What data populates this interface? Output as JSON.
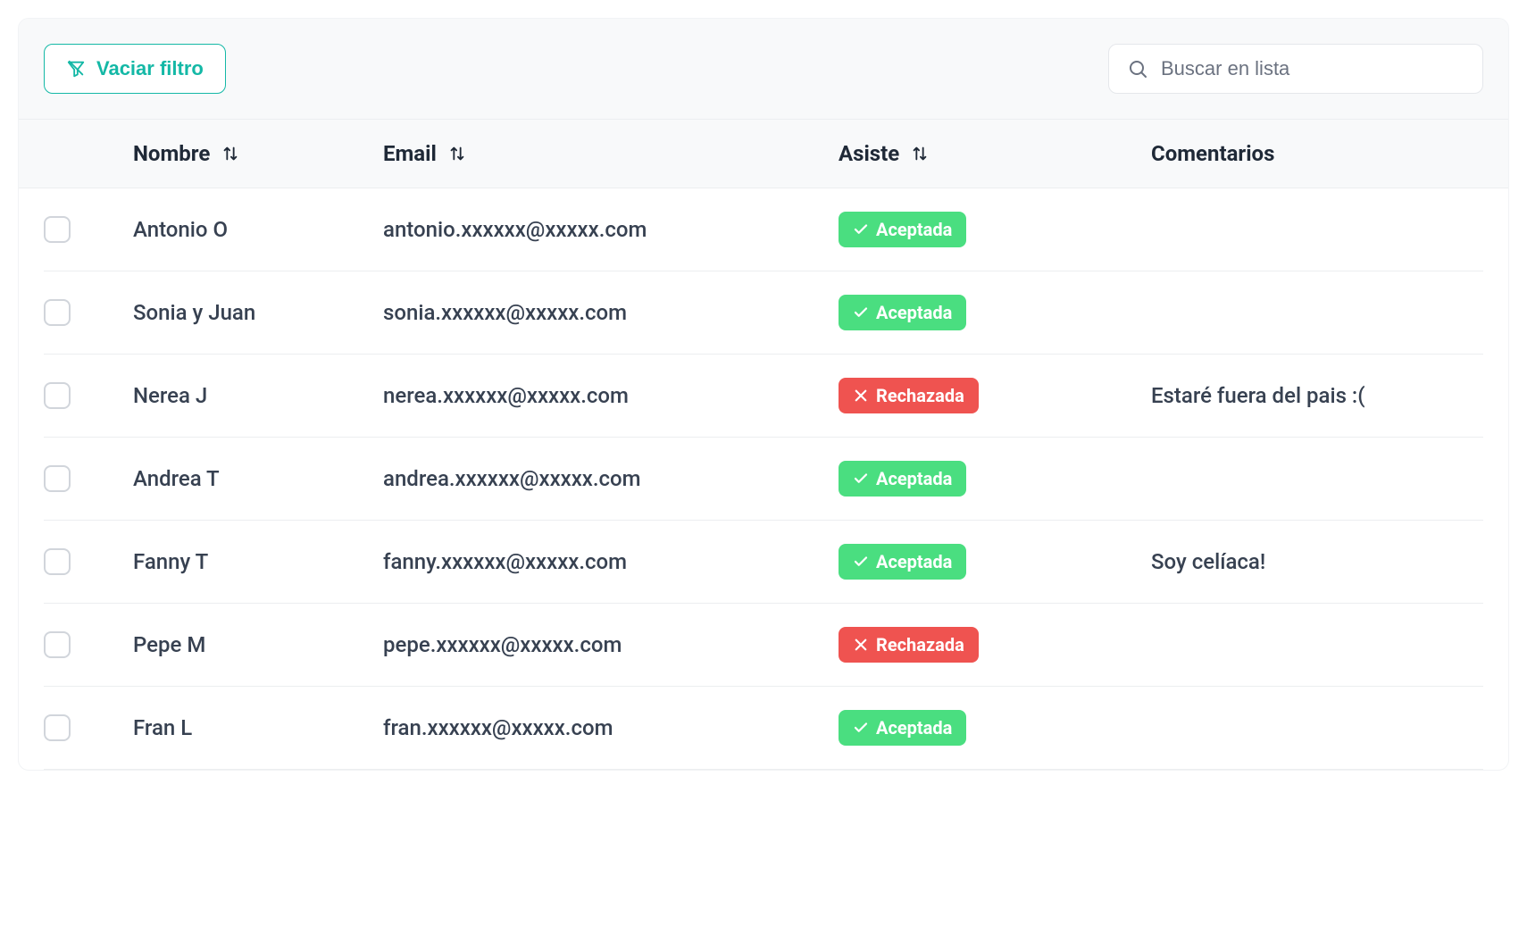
{
  "toolbar": {
    "clear_filter_label": "Vaciar filtro",
    "search_placeholder": "Buscar en lista"
  },
  "columns": {
    "name": "Nombre",
    "email": "Email",
    "attends": "Asiste",
    "comments": "Comentarios"
  },
  "status_labels": {
    "accepted": "Aceptada",
    "rejected": "Rechazada"
  },
  "rows": [
    {
      "name": "Antonio O",
      "email": "antonio.xxxxxx@xxxxx.com",
      "status": "accepted",
      "comment": ""
    },
    {
      "name": "Sonia y Juan",
      "email": "sonia.xxxxxx@xxxxx.com",
      "status": "accepted",
      "comment": ""
    },
    {
      "name": "Nerea J",
      "email": "nerea.xxxxxx@xxxxx.com",
      "status": "rejected",
      "comment": "Estaré fuera del pais :("
    },
    {
      "name": "Andrea T",
      "email": "andrea.xxxxxx@xxxxx.com",
      "status": "accepted",
      "comment": ""
    },
    {
      "name": "Fanny T",
      "email": "fanny.xxxxxx@xxxxx.com",
      "status": "accepted",
      "comment": "Soy celíaca!"
    },
    {
      "name": "Pepe M",
      "email": "pepe.xxxxxx@xxxxx.com",
      "status": "rejected",
      "comment": ""
    },
    {
      "name": "Fran L",
      "email": "fran.xxxxxx@xxxxx.com",
      "status": "accepted",
      "comment": ""
    }
  ]
}
